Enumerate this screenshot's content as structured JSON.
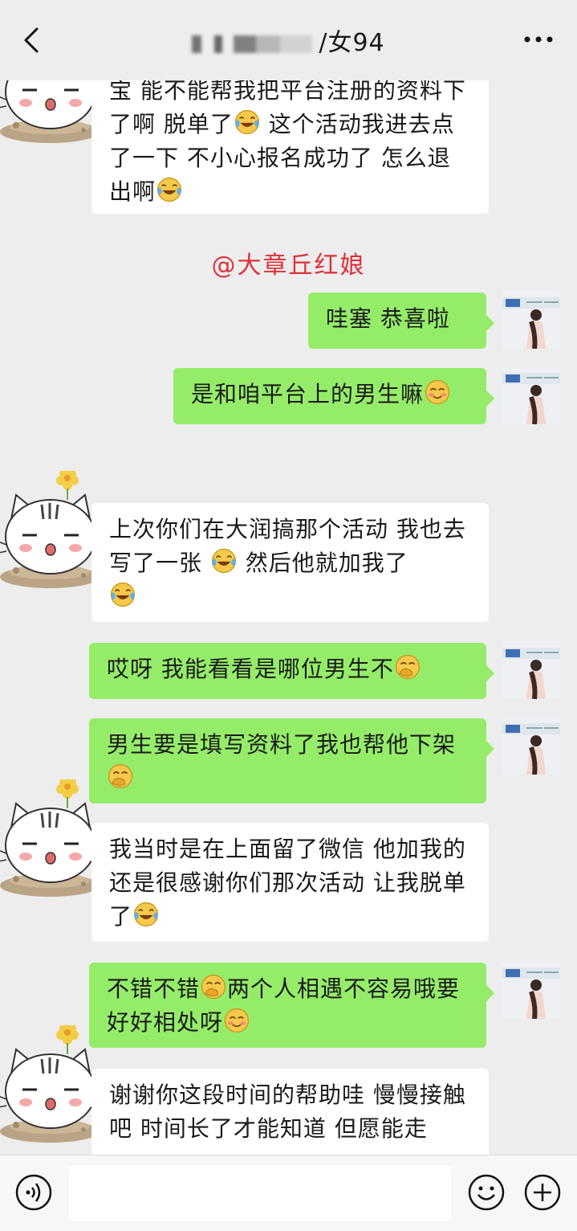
{
  "header": {
    "title": "/女94",
    "back_icon": "chevron-left-icon",
    "more_icon": "more-dots-icon"
  },
  "mention": "@大章丘红娘",
  "messages": [
    {
      "side": "left",
      "text_a": "宝 能不能帮我把平台注册的资料下了啊 脱单了",
      "emoji_a": "laugh-tears",
      "text_b": " 这个活动我进去点了一下 不小心报名成功了 怎么退出啊",
      "emoji_b": "laugh-tears"
    },
    {
      "side": "right",
      "text": "哇塞  恭喜啦"
    },
    {
      "side": "right",
      "text": "是和咱平台上的男生嘛",
      "emoji": "smile-blush"
    },
    {
      "side": "left",
      "text_a": "上次你们在大润搞那个活动 我也去写了一张 ",
      "emoji_a": "laugh-tears",
      "text_b": " 然后他就加我了",
      "emoji_b": "laugh-tears"
    },
    {
      "side": "right",
      "text": "哎呀   我能看看是哪位男生不",
      "emoji": "hand-over-mouth"
    },
    {
      "side": "right",
      "text": "男生要是填写资料了我也帮他下架",
      "emoji": "hand-over-mouth"
    },
    {
      "side": "left",
      "text": "我当时是在上面留了微信 他加我的 还是很感谢你们那次活动 让我脱单了",
      "emoji": "laugh-tears"
    },
    {
      "side": "right",
      "text_a": "不错不错",
      "emoji_a": "hand-over-mouth",
      "text_b": "两个人相遇不容易哦要好好相处呀",
      "emoji_b": "smile-blush"
    },
    {
      "side": "left",
      "text": "谢谢你这段时间的帮助哇 慢慢接触吧 时间长了才能知道 但愿能走"
    }
  ],
  "footer": {
    "voice_icon": "voice-icon",
    "emoji_icon": "emoji-icon",
    "plus_icon": "plus-icon"
  },
  "colors": {
    "background": "#ededed",
    "bubble_self": "#95ec69",
    "bubble_other": "#ffffff",
    "mention": "#e0303a"
  }
}
